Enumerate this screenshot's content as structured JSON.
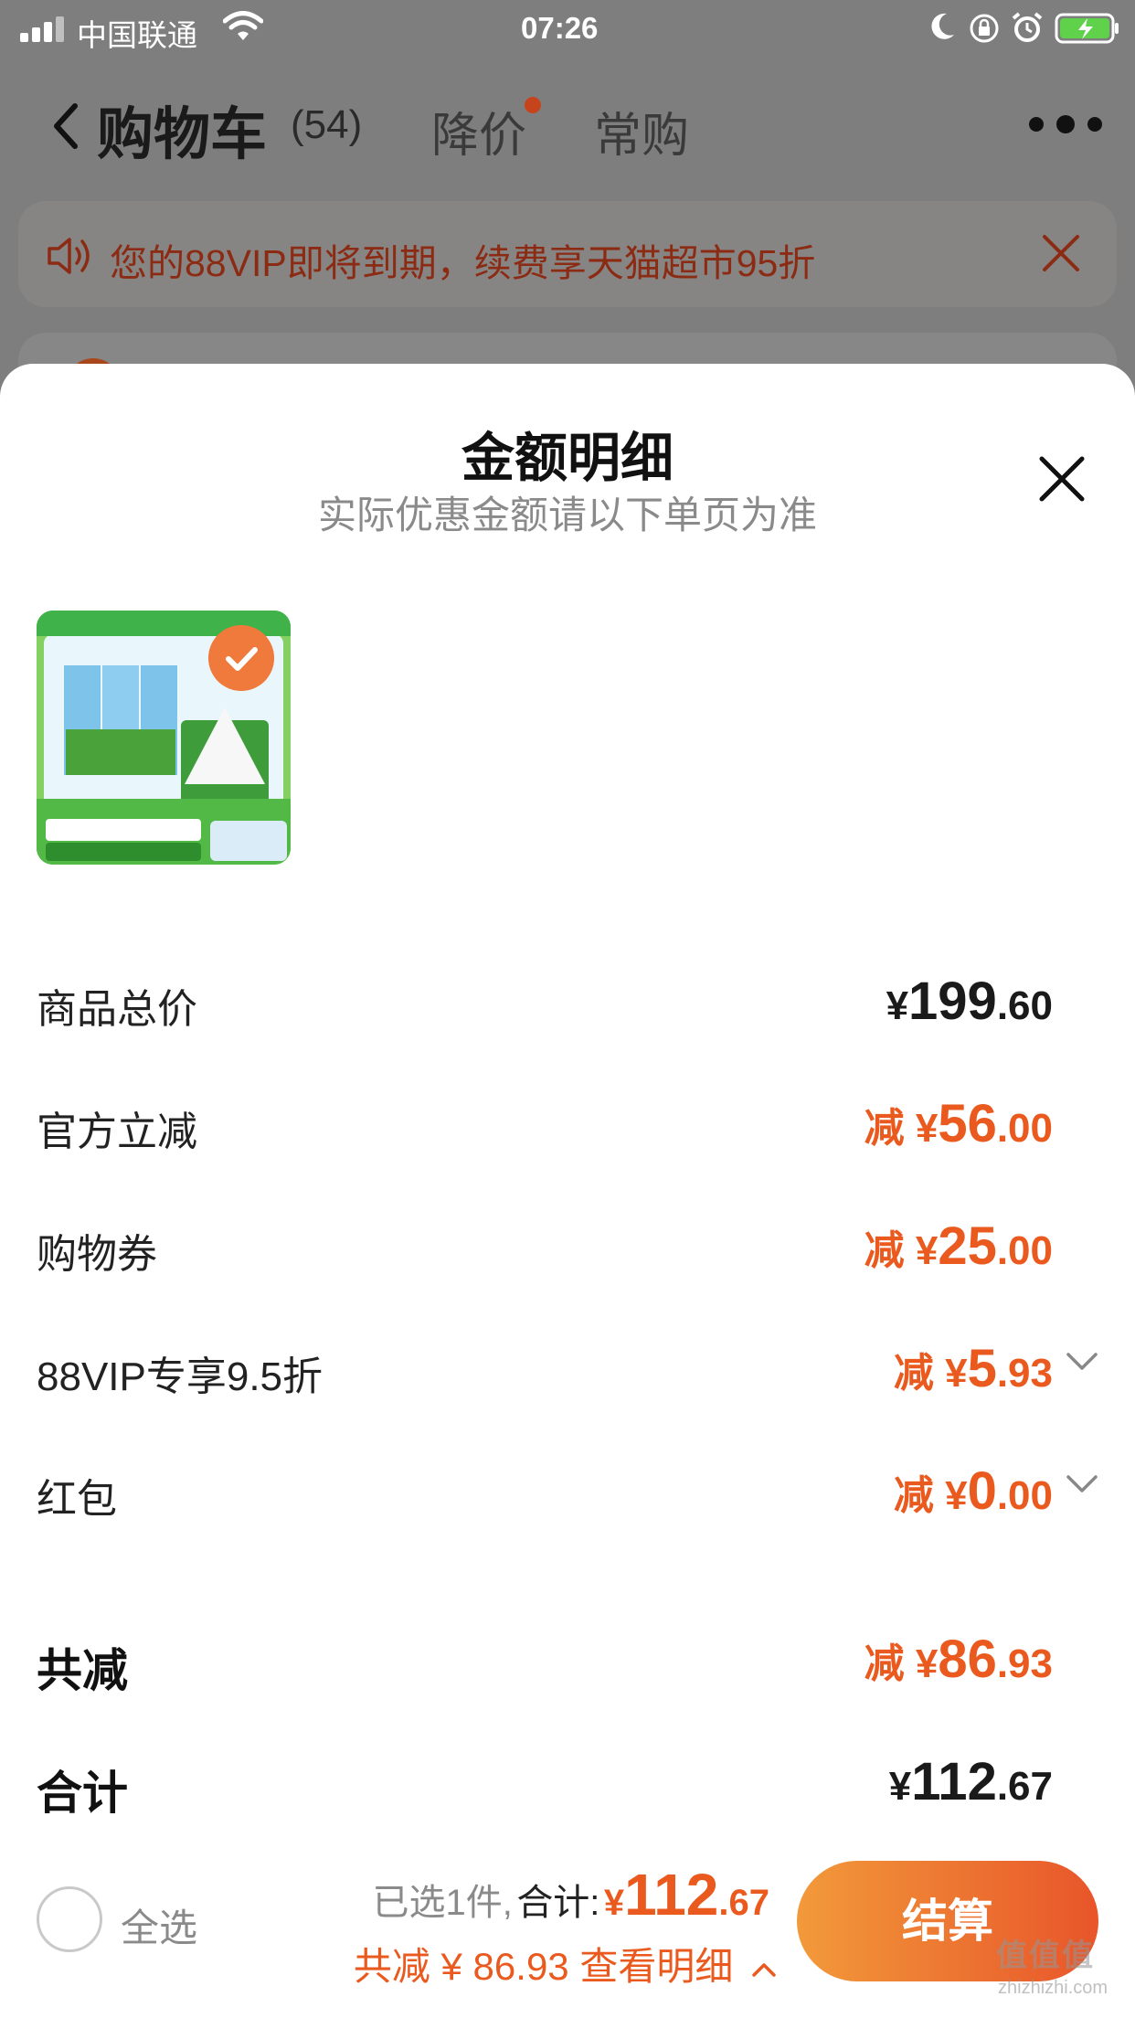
{
  "status_bar": {
    "carrier": "中国联通",
    "time": "07:26"
  },
  "nav": {
    "title": "购物车",
    "count": "(54)",
    "tabs": [
      "降价",
      "常购"
    ]
  },
  "notice": {
    "text": "您的88VIP即将到期，续费享天猫超市95折"
  },
  "sheet": {
    "title": "金额明细",
    "subtitle": "实际优惠金额请以下单页为准",
    "product_image_alt": "欧德堡纯牛奶",
    "rows": [
      {
        "label": "商品总价",
        "prefix": "¥",
        "int": "199",
        "dec": ".60",
        "discount": false,
        "expandable": false
      },
      {
        "label": "官方立减",
        "prefix": "减 ¥",
        "int": "56",
        "dec": ".00",
        "discount": true,
        "expandable": false
      },
      {
        "label": "购物券",
        "prefix": "减 ¥",
        "int": "25",
        "dec": ".00",
        "discount": true,
        "expandable": false
      },
      {
        "label": "88VIP专享9.5折",
        "prefix": "减 ¥",
        "int": "5",
        "dec": ".93",
        "discount": true,
        "expandable": true
      },
      {
        "label": "红包",
        "prefix": "减 ¥",
        "int": "0",
        "dec": ".00",
        "discount": true,
        "expandable": true
      }
    ],
    "total_discount": {
      "label": "共减",
      "prefix": "减 ¥",
      "int": "86",
      "dec": ".93"
    },
    "total": {
      "label": "合计",
      "prefix": "¥",
      "int": "112",
      "dec": ".67"
    }
  },
  "bottom_bar": {
    "select_all_label": "全选",
    "selected_text": "已选1件,",
    "sum_label": "合计:",
    "currency": "¥",
    "sum_int": "112",
    "sum_dec": ".67",
    "savings_text": "共减 ¥ 86.93 查看明细",
    "checkout_label": "结算"
  },
  "watermark": {
    "text": "值值值",
    "url": "zhizhizhi.com"
  },
  "colors": {
    "accent": "#ea5a1f",
    "checkout_start": "#f29a3a",
    "checkout_end": "#e8552a"
  },
  "icons": [
    "signal-icon",
    "wifi-icon",
    "moon-icon",
    "lock-rotation-icon",
    "alarm-icon",
    "battery-icon",
    "back-icon",
    "more-icon",
    "speaker-icon",
    "close-icon",
    "check-icon",
    "chevron-down-icon",
    "caret-up-icon"
  ]
}
